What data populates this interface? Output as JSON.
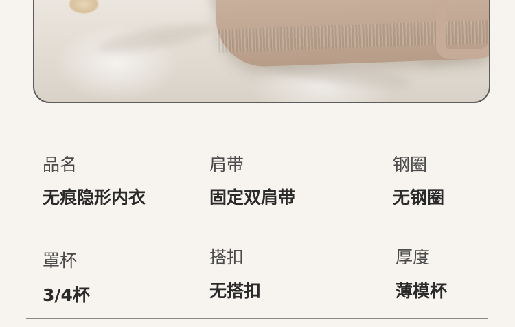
{
  "specs": [
    {
      "label": "品名",
      "value": "无痕隐形内衣"
    },
    {
      "label": "肩带",
      "value": "固定双肩带"
    },
    {
      "label": "钢圈",
      "value": "无钢圈"
    },
    {
      "label": "罩杯",
      "value": "3/4杯"
    },
    {
      "label": "搭扣",
      "value": "无搭扣"
    },
    {
      "label": "厚度",
      "value": "薄模杯"
    }
  ]
}
